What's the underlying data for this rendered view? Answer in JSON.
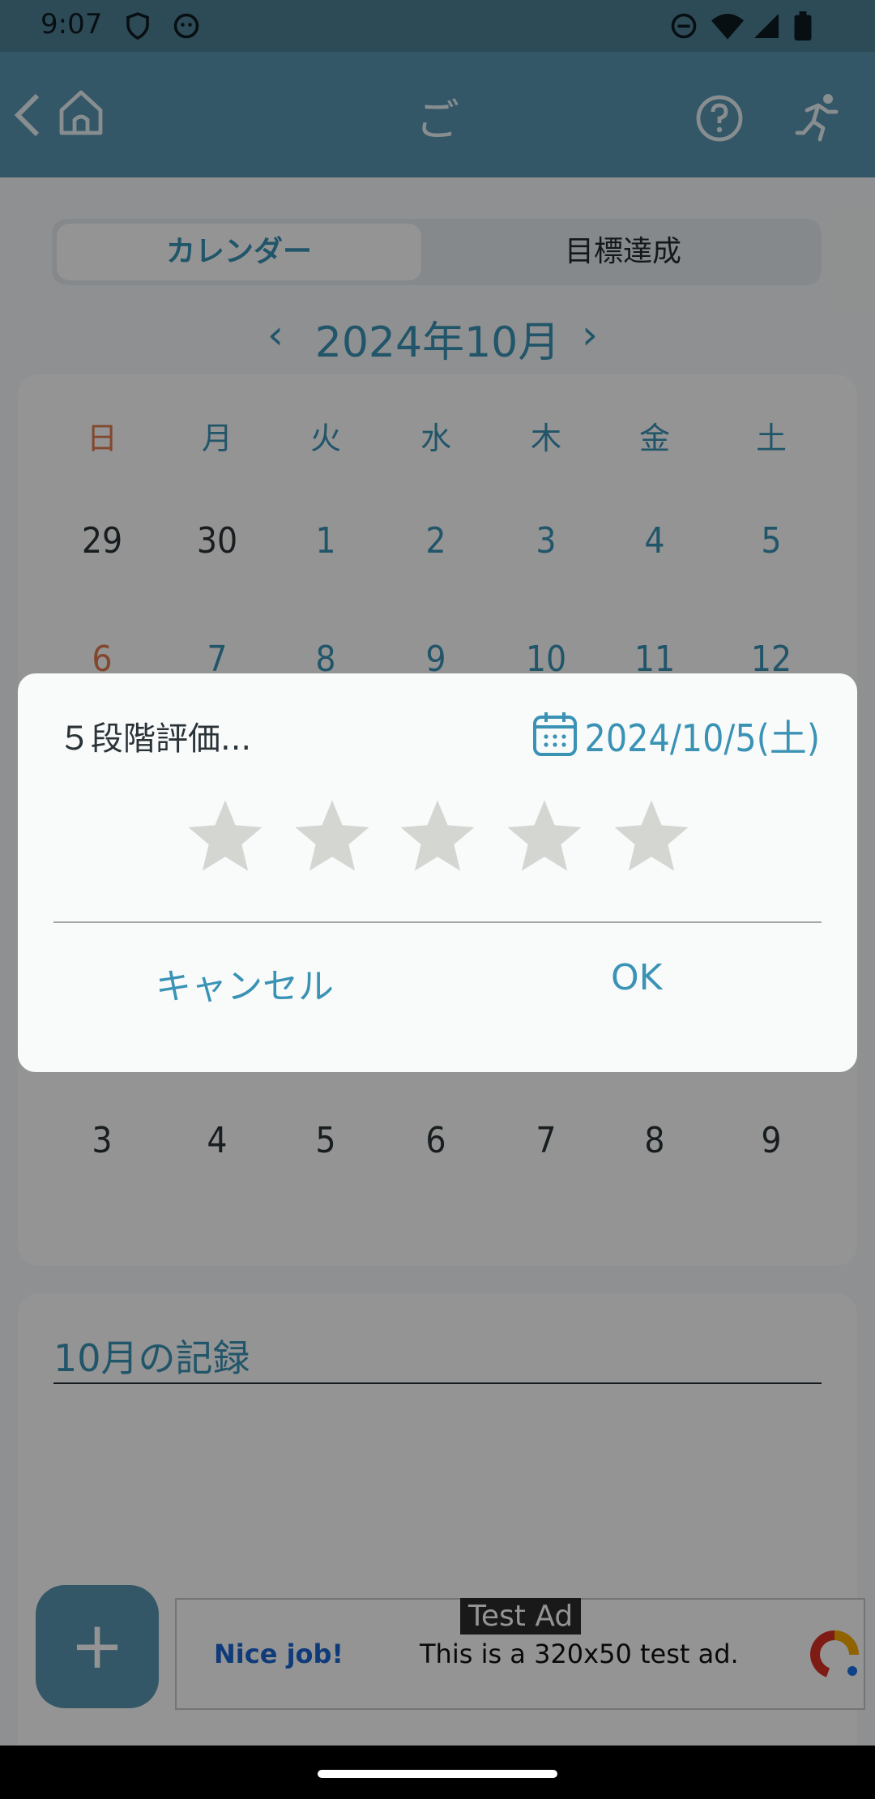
{
  "status": {
    "time": "9:07"
  },
  "appbar": {
    "title": "ご"
  },
  "tabs": {
    "calendar": "カレンダー",
    "goal": "目標達成"
  },
  "month": {
    "label": "2024年10月"
  },
  "calendar": {
    "weekdays": [
      "日",
      "月",
      "火",
      "水",
      "木",
      "金",
      "土"
    ],
    "row1": [
      "29",
      "30",
      "1",
      "2",
      "3",
      "4",
      "5"
    ],
    "row2": [
      "6",
      "7",
      "8",
      "9",
      "10",
      "11",
      "12"
    ],
    "row_last": [
      "3",
      "4",
      "5",
      "6",
      "7",
      "8",
      "9"
    ]
  },
  "records": {
    "title": "10月の記録"
  },
  "fab": {
    "label": "+"
  },
  "ad": {
    "tag": "Test Ad",
    "headline": "Nice job!",
    "message": "This is a 320x50 test ad."
  },
  "dialog": {
    "title": "５段階評価...",
    "date": "2024/10/5(土)",
    "rating": 0,
    "max_rating": 5,
    "cancel": "キャンセル",
    "ok": "OK"
  },
  "colors": {
    "accent": "#3a93b5",
    "appbar": "#5a97b1",
    "star": "#d4d6d2"
  }
}
